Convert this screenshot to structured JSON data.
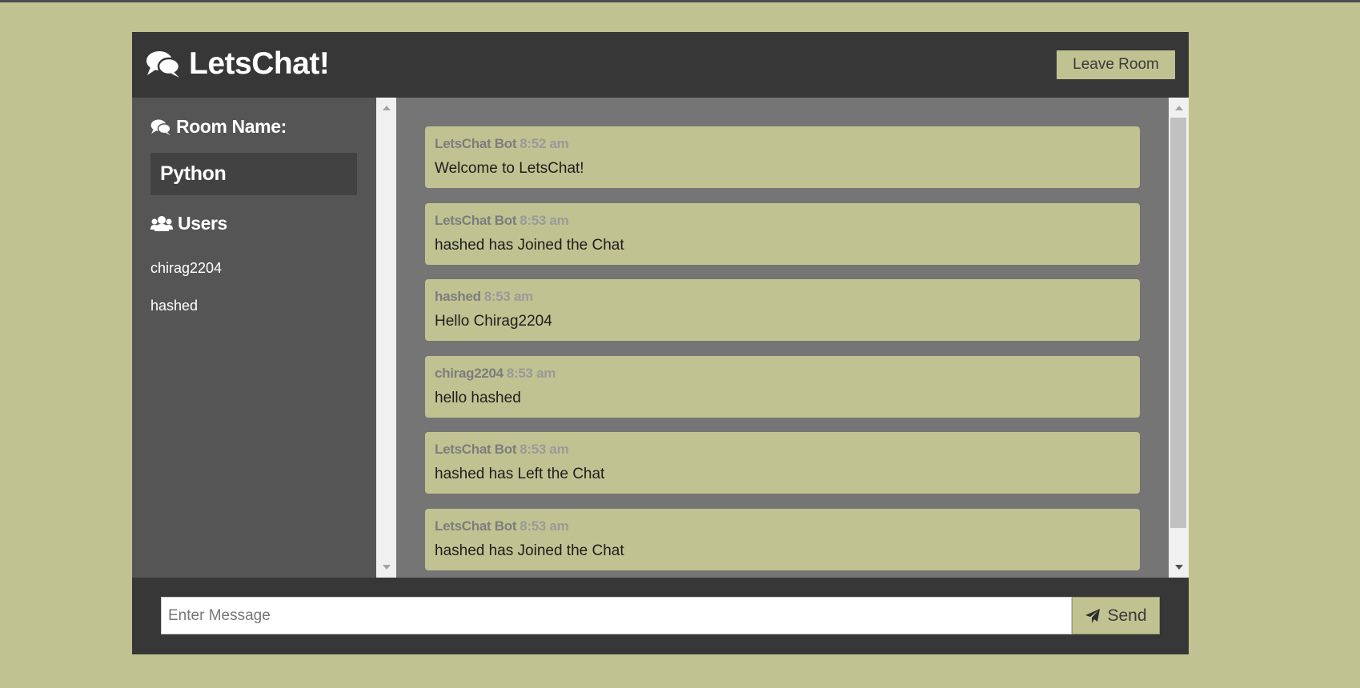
{
  "header": {
    "title": "LetsChat!",
    "leave_label": "Leave Room"
  },
  "sidebar": {
    "room_heading": "Room Name:",
    "room_name": "Python",
    "users_heading": "Users",
    "users": [
      "chirag2204",
      "hashed"
    ]
  },
  "messages": [
    {
      "sender": "LetsChat Bot",
      "time": "8:52 am",
      "text": "Welcome to LetsChat!"
    },
    {
      "sender": "LetsChat Bot",
      "time": "8:53 am",
      "text": "hashed has Joined the Chat"
    },
    {
      "sender": "hashed",
      "time": "8:53 am",
      "text": "Hello Chirag2204"
    },
    {
      "sender": "chirag2204",
      "time": "8:53 am",
      "text": "hello hashed"
    },
    {
      "sender": "LetsChat Bot",
      "time": "8:53 am",
      "text": "hashed has Left the Chat"
    },
    {
      "sender": "LetsChat Bot",
      "time": "8:53 am",
      "text": "hashed has Joined the Chat"
    }
  ],
  "composer": {
    "placeholder": "Enter Message",
    "value": "",
    "send_label": "Send"
  },
  "colors": {
    "background": "#c1c291",
    "header": "#373737",
    "sidebar": "#555555",
    "chat_area": "#757575",
    "message_bubble": "#c1c291"
  },
  "icons": {
    "brand": "comments-icon",
    "room": "comments-icon",
    "users": "users-icon",
    "send": "paper-plane-icon"
  }
}
